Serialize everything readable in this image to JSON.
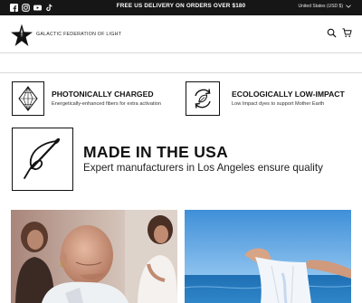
{
  "announcement": {
    "message": "FREE US DELIVERY ON ORDERS OVER $180",
    "region": "United States (USD $)",
    "socials": [
      "facebook-icon",
      "instagram-icon",
      "youtube-icon",
      "tiktok-icon"
    ]
  },
  "header": {
    "brand": "GALACTIC FEDERATION OF LIGHT",
    "icons": [
      "search-icon",
      "cart-icon"
    ]
  },
  "features": [
    {
      "title": "PHOTONICALLY CHARGED",
      "subtitle": "Energetically-enhanced fibers for extra activation",
      "icon": "diamond-pyramid-icon"
    },
    {
      "title": "ECOLOGICALLY LOW-IMPACT",
      "subtitle": "Low Impact dyes to support Mother Earth",
      "icon": "recycle-leaf-icon"
    }
  ],
  "highlight": {
    "title": "MADE IN THE USA",
    "subtitle": "Expert manufacturers in Los Angeles ensure quality",
    "icon": "sewing-needle-icon"
  },
  "gallery": [
    "people-photo",
    "beach-shirt-photo"
  ],
  "colors": {
    "announcement_bg": "#161616",
    "text": "#111111",
    "rule": "#d9d9d9"
  }
}
